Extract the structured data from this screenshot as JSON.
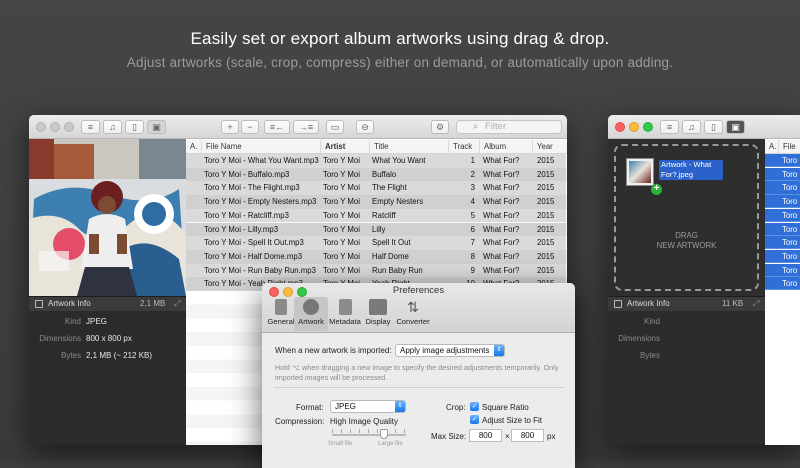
{
  "headline": "Easily set or export album artworks using drag & drop.",
  "subheadline": "Adjust artworks (scale, crop, compress) either on demand, or automatically upon adding.",
  "main_window": {
    "filter_placeholder": "Filter",
    "artwork_info": {
      "title": "Artwork Info",
      "size": "2,1 MB",
      "rows": [
        {
          "key": "Kind",
          "value": "JPEG"
        },
        {
          "key": "Dimensions",
          "value": "800 x 800 px"
        },
        {
          "key": "Bytes",
          "value": "2,1 MB (~ 212 KB)"
        }
      ]
    },
    "columns": [
      "A.",
      "File Name",
      "Artist",
      "Title",
      "Track №",
      "Album",
      "Year"
    ],
    "rows": [
      {
        "file": "Toro Y Moi - What You Want.mp3",
        "artist": "Toro Y Moi",
        "title": "What You Want",
        "track": "1",
        "album": "What For?",
        "year": "2015"
      },
      {
        "file": "Toro Y Moi - Buffalo.mp3",
        "artist": "Toro Y Moi",
        "title": "Buffalo",
        "track": "2",
        "album": "What For?",
        "year": "2015"
      },
      {
        "file": "Toro Y Moi - The Flight.mp3",
        "artist": "Toro Y Moi",
        "title": "The Flight",
        "track": "3",
        "album": "What For?",
        "year": "2015"
      },
      {
        "file": "Toro Y Moi - Empty Nesters.mp3",
        "artist": "Toro Y Moi",
        "title": "Empty Nesters",
        "track": "4",
        "album": "What For?",
        "year": "2015"
      },
      {
        "file": "Toro Y Moi - Ratcliff.mp3",
        "artist": "Toro Y Moi",
        "title": "Ratcliff",
        "track": "5",
        "album": "What For?",
        "year": "2015"
      },
      {
        "file": "Toro Y Moi - Lilly.mp3",
        "artist": "Toro Y Moi",
        "title": "Lilly",
        "track": "6",
        "album": "What For?",
        "year": "2015"
      },
      {
        "file": "Toro Y Moi - Spell It Out.mp3",
        "artist": "Toro Y Moi",
        "title": "Spell It Out",
        "track": "7",
        "album": "What For?",
        "year": "2015"
      },
      {
        "file": "Toro Y Moi - Half Dome.mp3",
        "artist": "Toro Y Moi",
        "title": "Half Dome",
        "track": "8",
        "album": "What For?",
        "year": "2015"
      },
      {
        "file": "Toro Y Moi - Run Baby Run.mp3",
        "artist": "Toro Y Moi",
        "title": "Run Baby Run",
        "track": "9",
        "album": "What For?",
        "year": "2015"
      },
      {
        "file": "Toro Y Moi - Yeah Right.mp3",
        "artist": "Toro Y Moi",
        "title": "Yeah Right",
        "track": "10",
        "album": "What For?",
        "year": "2015"
      }
    ]
  },
  "right_window": {
    "drag_file_label": "Artwork - What For?.jpeg",
    "drop_text": "DRAG\nNEW ARTWORK",
    "artwork_info": {
      "title": "Artwork Info",
      "size": "11 KB",
      "rows": [
        {
          "key": "Kind"
        },
        {
          "key": "Dimensions"
        },
        {
          "key": "Bytes"
        }
      ]
    },
    "col_a": "A.",
    "col_file": "File",
    "file_prefix": "Toro"
  },
  "preferences": {
    "title": "Preferences",
    "tabs": [
      "General",
      "Artwork",
      "Metadata",
      "Display",
      "Converter"
    ],
    "imported_label": "When a new artwork is imported:",
    "imported_value": "Apply image adjustments",
    "hint": "Hold ⌥ when dragging a new image to specify the desired adjustments temporarily. Only imported images will be processed.",
    "format_label": "Format:",
    "format_value": "JPEG",
    "crop_label": "Crop:",
    "square_ratio": "Square Ratio",
    "adjust_size": "Adjust Size to Fit",
    "compression_label": "Compression:",
    "compression_value": "High Image Quality",
    "small_file": "Small file",
    "large_file": "Large file",
    "max_size_label": "Max Size:",
    "max_w": "800",
    "max_h": "800",
    "times": "×",
    "unit": "px"
  }
}
